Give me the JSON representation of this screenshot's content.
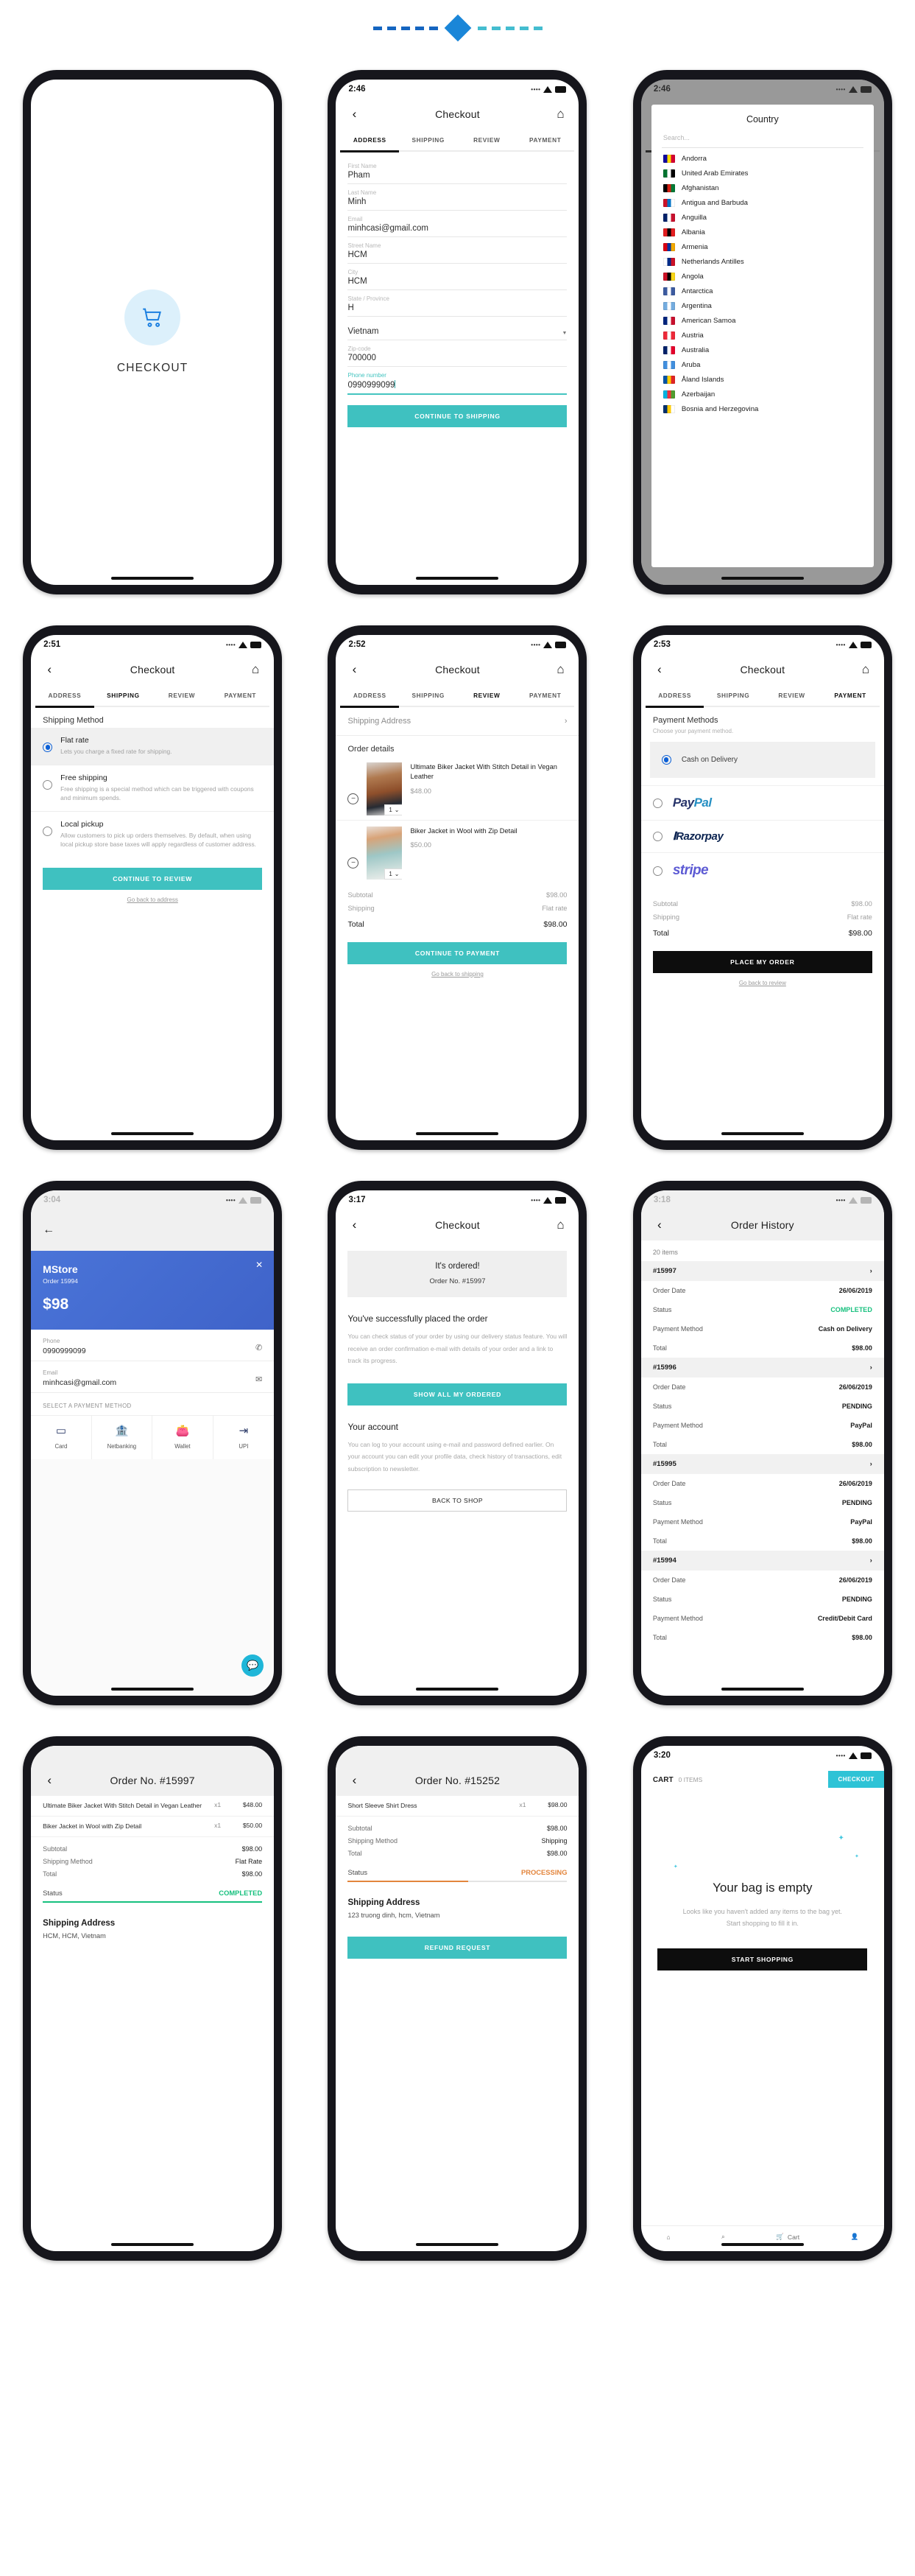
{
  "decor": {
    "dash_color": "#1565c0",
    "diamond_color": "#1a86d8",
    "light_dash_color": "#44bdd0"
  },
  "common": {
    "app_title": "Checkout",
    "back_icon": "chevron-left-icon",
    "home_icon": "home-icon",
    "tabs": [
      "ADDRESS",
      "SHIPPING",
      "REVIEW",
      "PAYMENT"
    ]
  },
  "screens": [
    {
      "id": "splash",
      "icon": "shopping-cart-icon",
      "title": "CHECKOUT"
    },
    {
      "id": "address",
      "status": {
        "time": "2:46",
        "wifi": "wifi-icon",
        "battery": "battery-icon"
      },
      "active_tab": 0,
      "fields": [
        {
          "label": "First Name",
          "value": "Pham"
        },
        {
          "label": "Last Name",
          "value": "Minh"
        },
        {
          "label": "Email",
          "value": "minhcasi@gmail.com"
        },
        {
          "label": "Street Name",
          "value": "HCM"
        },
        {
          "label": "City",
          "value": "HCM"
        },
        {
          "label": "State / Province",
          "value": "H"
        }
      ],
      "country_select": {
        "value": "Vietnam",
        "caret": "▼"
      },
      "zip": {
        "label": "Zip-code",
        "value": "700000"
      },
      "phone": {
        "label": "Phone number",
        "value": "0990999099"
      },
      "cta": "CONTINUE TO SHIPPING"
    },
    {
      "id": "country-picker",
      "status": {
        "time": "2:46"
      },
      "modal_title": "Country",
      "search_placeholder": "Search...",
      "countries": [
        {
          "name": "Andorra",
          "flag": [
            "#10069f",
            "#fedd00",
            "#d50032"
          ]
        },
        {
          "name": "United Arab Emirates",
          "flag": [
            "#00732f",
            "#ffffff",
            "#000000"
          ]
        },
        {
          "name": "Afghanistan",
          "flag": [
            "#000000",
            "#d32011",
            "#007a36"
          ]
        },
        {
          "name": "Antigua and Barbuda",
          "flag": [
            "#ce1126",
            "#0072c6",
            "#ffffff"
          ]
        },
        {
          "name": "Anguilla",
          "flag": [
            "#012169",
            "#ffffff",
            "#c8102e"
          ]
        },
        {
          "name": "Albania",
          "flag": [
            "#e41e20",
            "#000000",
            "#e41e20"
          ]
        },
        {
          "name": "Armenia",
          "flag": [
            "#d90012",
            "#0033a0",
            "#f2a800"
          ]
        },
        {
          "name": "Netherlands Antilles",
          "flag": [
            "#ffffff",
            "#012a87",
            "#cc1126"
          ]
        },
        {
          "name": "Angola",
          "flag": [
            "#ce1126",
            "#000000",
            "#f9d616"
          ]
        },
        {
          "name": "Antarctica",
          "flag": [
            "#3c5ba0",
            "#ffffff",
            "#3c5ba0"
          ]
        },
        {
          "name": "Argentina",
          "flag": [
            "#74acdf",
            "#ffffff",
            "#74acdf"
          ]
        },
        {
          "name": "American Samoa",
          "flag": [
            "#00247d",
            "#ffffff",
            "#c8102e"
          ]
        },
        {
          "name": "Austria",
          "flag": [
            "#ed2939",
            "#ffffff",
            "#ed2939"
          ]
        },
        {
          "name": "Australia",
          "flag": [
            "#012169",
            "#ffffff",
            "#e4002b"
          ]
        },
        {
          "name": "Aruba",
          "flag": [
            "#418fde",
            "#ffffff",
            "#418fde"
          ]
        },
        {
          "name": "Åland Islands",
          "flag": [
            "#0053a5",
            "#ffce00",
            "#e02526"
          ]
        },
        {
          "name": "Azerbaijan",
          "flag": [
            "#00b5e2",
            "#ef3340",
            "#509e2f"
          ]
        },
        {
          "name": "Bosnia and Herzegovina",
          "flag": [
            "#002f6c",
            "#fecb00",
            "#ffffff"
          ]
        }
      ]
    },
    {
      "id": "shipping",
      "status": {
        "time": "2:51"
      },
      "active_tab": 1,
      "section_title": "Shipping Method",
      "options": [
        {
          "name": "Flat rate",
          "desc": "Lets you charge a fixed rate for shipping.",
          "selected": true
        },
        {
          "name": "Free shipping",
          "desc": "Free shipping is a special method which can be triggered with coupons and minimum spends.",
          "selected": false
        },
        {
          "name": "Local pickup",
          "desc": "Allow customers to pick up orders themselves. By default, when using local pickup store base taxes will apply regardless of customer address.",
          "selected": false
        }
      ],
      "cta": "CONTINUE TO REVIEW",
      "back_link": "Go back to address"
    },
    {
      "id": "review",
      "status": {
        "time": "2:52"
      },
      "active_tab": 2,
      "shipping_address_row": "Shipping Address",
      "order_details_title": "Order details",
      "items": [
        {
          "name": "Ultimate Biker Jacket With Stitch Detail in Vegan Leather",
          "price": "$48.00",
          "qty": "1"
        },
        {
          "name": "Biker Jacket in Wool with Zip Detail",
          "price": "$50.00",
          "qty": "1"
        }
      ],
      "totals": [
        {
          "label": "Subtotal",
          "value": "$98.00"
        },
        {
          "label": "Shipping",
          "value": "Flat rate"
        },
        {
          "label": "Total",
          "value": "$98.00",
          "bold": true
        }
      ],
      "cta": "CONTINUE TO PAYMENT",
      "back_link": "Go back to shipping"
    },
    {
      "id": "payment",
      "status": {
        "time": "2:53"
      },
      "active_tab": 3,
      "section_title": "Payment Methods",
      "section_note": "Choose your payment method.",
      "methods": [
        {
          "label": "Cash on Delivery",
          "selected": true,
          "type": "text"
        },
        {
          "label": "PayPal",
          "selected": false,
          "type": "paypal"
        },
        {
          "label": "Razorpay",
          "selected": false,
          "type": "razorpay"
        },
        {
          "label": "stripe",
          "selected": false,
          "type": "stripe"
        }
      ],
      "totals": [
        {
          "label": "Subtotal",
          "value": "$98.00"
        },
        {
          "label": "Shipping",
          "value": "Flat rate"
        },
        {
          "label": "Total",
          "value": "$98.00",
          "bold": true
        }
      ],
      "cta": "PLACE MY ORDER",
      "back_link": "Go back to review"
    },
    {
      "id": "payment-sheet",
      "status": {
        "time": "3:04"
      },
      "store": "MStore",
      "order": "Order 15994",
      "amount": "$98",
      "close_icon": "close-icon",
      "phone": {
        "label": "Phone",
        "value": "0990999099",
        "icon": "phone-icon"
      },
      "email": {
        "label": "Email",
        "value": "minhcasi@gmail.com",
        "icon": "mail-icon"
      },
      "select_label": "SELECT A PAYMENT METHOD",
      "methods": [
        {
          "label": "Card",
          "icon": "credit-card-icon"
        },
        {
          "label": "Netbanking",
          "icon": "bank-icon"
        },
        {
          "label": "Wallet",
          "icon": "wallet-icon"
        },
        {
          "label": "UPI",
          "icon": "upi-icon"
        }
      ],
      "fab_icon": "chat-icon"
    },
    {
      "id": "ordered",
      "status": {
        "time": "3:17"
      },
      "banner_title": "It's ordered!",
      "banner_sub": "Order No. #15997",
      "heading": "You've successfully placed the order",
      "paragraph": "You can check status of your order by using our delivery status feature. You will receive an order confirmation e-mail with details of your order and a link to track its progress.",
      "cta": "SHOW ALL MY ORDERED",
      "account_heading": "Your account",
      "account_paragraph": "You can log to your account using e-mail and password defined earlier. On your account you can edit your profile data, check history of transactions, edit subscription to newsletter.",
      "secondary_cta": "BACK TO SHOP"
    },
    {
      "id": "order-history",
      "status": {
        "time": "3:18"
      },
      "title": "Order History",
      "count": "20 items",
      "orders": [
        {
          "id": "#15997",
          "date": "26/06/2019",
          "status": "COMPLETED",
          "payment": "Cash on Delivery",
          "total": "$98.00"
        },
        {
          "id": "#15996",
          "date": "26/06/2019",
          "status": "PENDING",
          "payment": "PayPal",
          "total": "$98.00"
        },
        {
          "id": "#15995",
          "date": "26/06/2019",
          "status": "PENDING",
          "payment": "PayPal",
          "total": "$98.00"
        },
        {
          "id": "#15994",
          "date": "26/06/2019",
          "status": "PENDING",
          "payment": "Credit/Debit Card",
          "total": "$98.00"
        }
      ],
      "labels": {
        "date": "Order Date",
        "status": "Status",
        "payment": "Payment Method",
        "total": "Total"
      }
    },
    {
      "id": "order-15997",
      "title": "Order No. #15997",
      "items": [
        {
          "name": "Ultimate Biker Jacket With Stitch Detail in Vegan Leather",
          "qty": "x1",
          "price": "$48.00"
        },
        {
          "name": "Biker Jacket in Wool with Zip Detail",
          "qty": "x1",
          "price": "$50.00"
        }
      ],
      "kv": [
        {
          "k": "Subtotal",
          "v": "$98.00"
        },
        {
          "k": "Shipping Method",
          "v": "Flat Rate"
        },
        {
          "k": "Total",
          "v": "$98.00"
        }
      ],
      "status_label": "Status",
      "status_value": "COMPLETED",
      "progress": 100,
      "address_title": "Shipping Address",
      "address_body": "HCM, HCM, Vietnam"
    },
    {
      "id": "order-15252",
      "title": "Order No. #15252",
      "items": [
        {
          "name": "Short Sleeve Shirt Dress",
          "qty": "x1",
          "price": "$98.00"
        }
      ],
      "kv": [
        {
          "k": "Subtotal",
          "v": "$98.00"
        },
        {
          "k": "Shipping Method",
          "v": "Shipping"
        },
        {
          "k": "Total",
          "v": "$98.00"
        }
      ],
      "status_label": "Status",
      "status_value": "PROCESSING",
      "progress": 55,
      "address_title": "Shipping Address",
      "address_body": "123 truong dinh, hcm, Vietnam",
      "cta": "REFUND REQUEST"
    },
    {
      "id": "empty-cart",
      "status": {
        "time": "3:20"
      },
      "cart_label": "CART",
      "cart_count": "0 ITEMS",
      "checkout_btn": "CHECKOUT",
      "empty_title": "Your bag is empty",
      "empty_text": "Looks like you haven't added any items to the bag yet. Start shopping to fill it in.",
      "shop_btn": "START SHOPPING",
      "nav": [
        {
          "label": "",
          "icon": "home-icon"
        },
        {
          "label": "",
          "icon": "search-icon"
        },
        {
          "label": "Cart",
          "icon": "cart-icon"
        },
        {
          "label": "",
          "icon": "user-icon"
        }
      ]
    }
  ]
}
